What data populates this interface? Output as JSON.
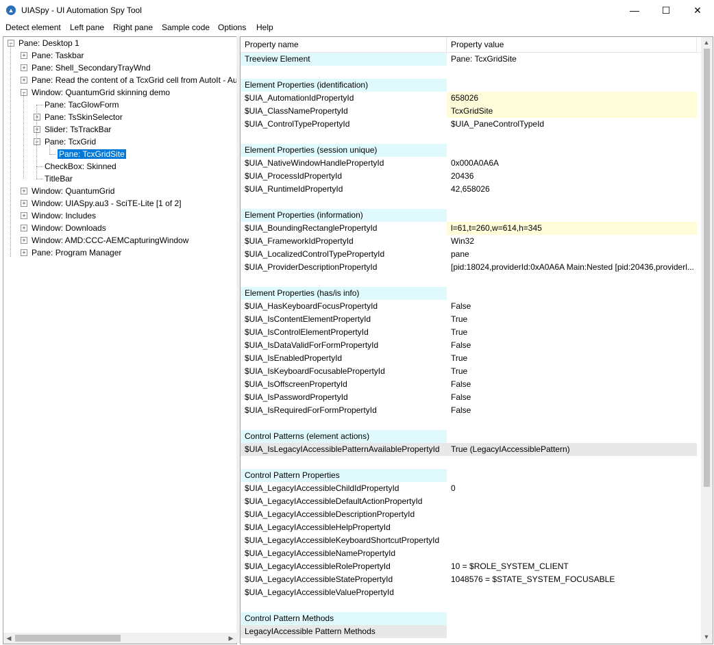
{
  "window": {
    "title": "UIASpy - UI Automation Spy Tool",
    "minimize": "—",
    "maximize": "☐",
    "close": "✕"
  },
  "menu": [
    "Detect element",
    "Left pane",
    "Right pane",
    "Sample code",
    "Options",
    "Help"
  ],
  "tree": [
    {
      "label": "Pane: Desktop 1",
      "toggle": "−"
    },
    {
      "label": "Pane: Taskbar",
      "toggle": "+"
    },
    {
      "label": "Pane: Shell_SecondaryTrayWnd",
      "toggle": "+"
    },
    {
      "label": "Pane: Read the content of a TcxGrid cell from AutoIt - AutoIt General Help and Support",
      "toggle": "+"
    },
    {
      "label": "Window: QuantumGrid skinning demo",
      "toggle": "−"
    },
    {
      "label": "Pane: TacGlowForm",
      "toggle": ""
    },
    {
      "label": "Pane: TsSkinSelector",
      "toggle": "+"
    },
    {
      "label": "Slider: TsTrackBar",
      "toggle": "+"
    },
    {
      "label": "Pane: TcxGrid",
      "toggle": "−"
    },
    {
      "label": "Pane: TcxGridSite",
      "toggle": "",
      "selected": true
    },
    {
      "label": "CheckBox: Skinned",
      "toggle": ""
    },
    {
      "label": "TitleBar",
      "toggle": ""
    },
    {
      "label": "Window: QuantumGrid",
      "toggle": "+"
    },
    {
      "label": "Window: UIASpy.au3 - SciTE-Lite [1 of 2]",
      "toggle": "+"
    },
    {
      "label": "Window: Includes",
      "toggle": "+"
    },
    {
      "label": "Window: Downloads",
      "toggle": "+"
    },
    {
      "label": "Window: AMD:CCC-AEMCapturingWindow",
      "toggle": "+"
    },
    {
      "label": "Pane: Program Manager",
      "toggle": "+"
    }
  ],
  "table": {
    "headers": [
      "Property name",
      "Property value"
    ],
    "rows": [
      {
        "name": "Treeview Element",
        "value": "Pane: TcxGridSite",
        "style": "sec"
      },
      {
        "name": "",
        "value": "",
        "style": ""
      },
      {
        "name": "Element Properties (identification)",
        "value": "",
        "style": "sec"
      },
      {
        "name": "$UIA_AutomationIdPropertyId",
        "value": "658026",
        "style": "hl"
      },
      {
        "name": "$UIA_ClassNamePropertyId",
        "value": "TcxGridSite",
        "style": "hl"
      },
      {
        "name": "$UIA_ControlTypePropertyId",
        "value": "$UIA_PaneControlTypeId",
        "style": ""
      },
      {
        "name": "",
        "value": "",
        "style": ""
      },
      {
        "name": "Element Properties (session unique)",
        "value": "",
        "style": "sec"
      },
      {
        "name": "$UIA_NativeWindowHandlePropertyId",
        "value": "0x000A0A6A",
        "style": ""
      },
      {
        "name": "$UIA_ProcessIdPropertyId",
        "value": "20436",
        "style": ""
      },
      {
        "name": "$UIA_RuntimeIdPropertyId",
        "value": "42,658026",
        "style": ""
      },
      {
        "name": "",
        "value": "",
        "style": ""
      },
      {
        "name": "Element Properties (information)",
        "value": "",
        "style": "sec"
      },
      {
        "name": "$UIA_BoundingRectanglePropertyId",
        "value": "l=61,t=260,w=614,h=345",
        "style": "hl"
      },
      {
        "name": "$UIA_FrameworkIdPropertyId",
        "value": "Win32",
        "style": ""
      },
      {
        "name": "$UIA_LocalizedControlTypePropertyId",
        "value": "pane",
        "style": ""
      },
      {
        "name": "$UIA_ProviderDescriptionPropertyId",
        "value": "[pid:18024,providerId:0xA0A6A Main:Nested [pid:20436,providerl...",
        "style": ""
      },
      {
        "name": "",
        "value": "",
        "style": ""
      },
      {
        "name": "Element Properties (has/is info)",
        "value": "",
        "style": "sec"
      },
      {
        "name": "$UIA_HasKeyboardFocusPropertyId",
        "value": "False",
        "style": ""
      },
      {
        "name": "$UIA_IsContentElementPropertyId",
        "value": "True",
        "style": ""
      },
      {
        "name": "$UIA_IsControlElementPropertyId",
        "value": "True",
        "style": ""
      },
      {
        "name": "$UIA_IsDataValidForFormPropertyId",
        "value": "False",
        "style": ""
      },
      {
        "name": "$UIA_IsEnabledPropertyId",
        "value": "True",
        "style": ""
      },
      {
        "name": "$UIA_IsKeyboardFocusablePropertyId",
        "value": "True",
        "style": ""
      },
      {
        "name": "$UIA_IsOffscreenPropertyId",
        "value": "False",
        "style": ""
      },
      {
        "name": "$UIA_IsPasswordPropertyId",
        "value": "False",
        "style": ""
      },
      {
        "name": "$UIA_IsRequiredForFormPropertyId",
        "value": "False",
        "style": ""
      },
      {
        "name": "",
        "value": "",
        "style": ""
      },
      {
        "name": "Control Patterns (element actions)",
        "value": "",
        "style": "sec"
      },
      {
        "name": "$UIA_IsLegacyIAccessiblePatternAvailablePropertyId",
        "value": "True (LegacyIAccessiblePattern)",
        "style": "gr"
      },
      {
        "name": "",
        "value": "",
        "style": ""
      },
      {
        "name": "Control Pattern Properties",
        "value": "",
        "style": "sec"
      },
      {
        "name": "$UIA_LegacyIAccessibleChildIdPropertyId",
        "value": "0",
        "style": ""
      },
      {
        "name": "$UIA_LegacyIAccessibleDefaultActionPropertyId",
        "value": "",
        "style": ""
      },
      {
        "name": "$UIA_LegacyIAccessibleDescriptionPropertyId",
        "value": "",
        "style": ""
      },
      {
        "name": "$UIA_LegacyIAccessibleHelpPropertyId",
        "value": "",
        "style": ""
      },
      {
        "name": "$UIA_LegacyIAccessibleKeyboardShortcutPropertyId",
        "value": "",
        "style": ""
      },
      {
        "name": "$UIA_LegacyIAccessibleNamePropertyId",
        "value": "",
        "style": ""
      },
      {
        "name": "$UIA_LegacyIAccessibleRolePropertyId",
        "value": "10 = $ROLE_SYSTEM_CLIENT",
        "style": ""
      },
      {
        "name": "$UIA_LegacyIAccessibleStatePropertyId",
        "value": "1048576 = $STATE_SYSTEM_FOCUSABLE",
        "style": ""
      },
      {
        "name": "$UIA_LegacyIAccessibleValuePropertyId",
        "value": "",
        "style": ""
      },
      {
        "name": "",
        "value": "",
        "style": ""
      },
      {
        "name": "Control Pattern Methods",
        "value": "",
        "style": "sec"
      },
      {
        "name": "LegacyIAccessible Pattern Methods",
        "value": "",
        "style": "gr"
      }
    ]
  },
  "scroll": {
    "left_arrow": "◀",
    "right_arrow": "▶",
    "up_arrow": "▲",
    "down_arrow": "▼"
  }
}
